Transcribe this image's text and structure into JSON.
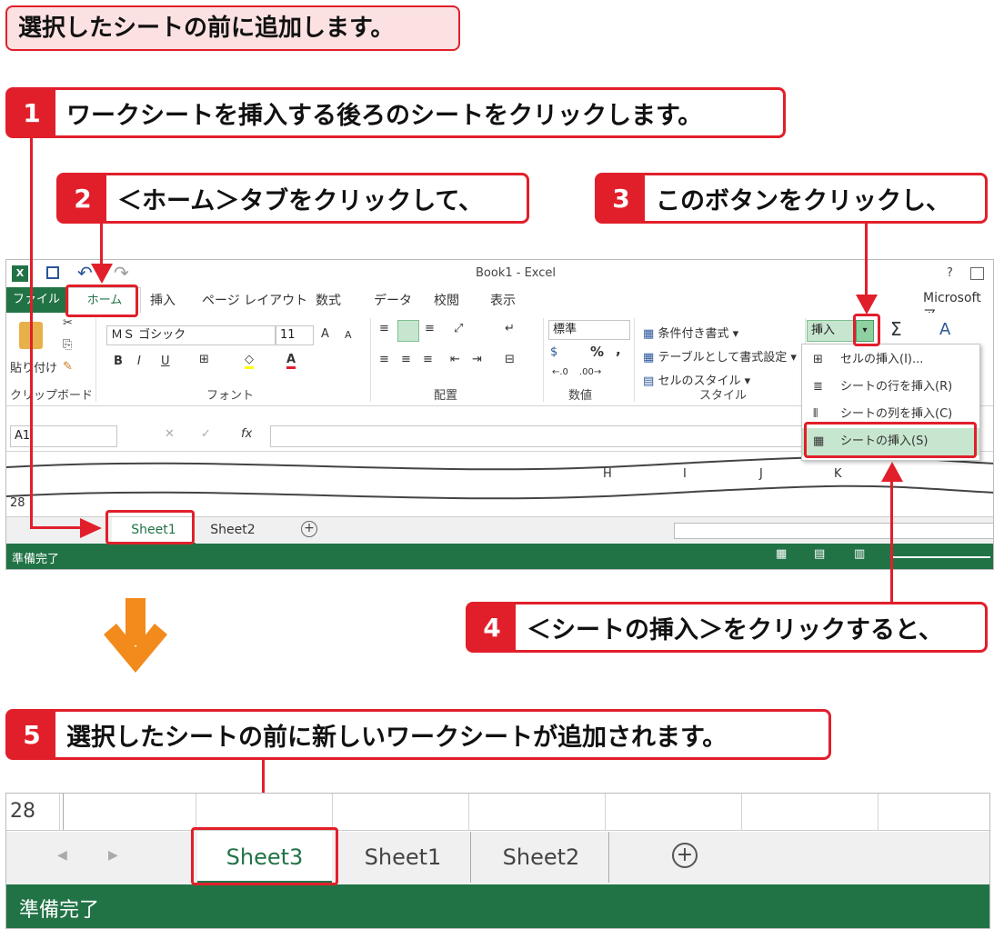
{
  "header_title": "選択したシートの前に追加します。",
  "steps": {
    "s1": {
      "num": "1",
      "text": "ワークシートを挿入する後ろのシートをクリックします。"
    },
    "s2": {
      "num": "2",
      "text": "＜ホーム＞タブをクリックして、"
    },
    "s3": {
      "num": "3",
      "text": "このボタンをクリックし、"
    },
    "s4": {
      "num": "4",
      "text": "＜シートの挿入＞をクリックすると、"
    },
    "s5": {
      "num": "5",
      "text": "選択したシートの前に新しいワークシートが追加されます。"
    }
  },
  "excel": {
    "window_title": "Book1 - Excel",
    "help": "?",
    "account": "Microsoft ア",
    "tabs": {
      "file": "ファイル",
      "home": "ホーム",
      "insert": "挿入",
      "layout": "ページ レイアウト",
      "formula": "数式",
      "data": "データ",
      "review": "校閲",
      "view": "表示"
    },
    "clipboard": {
      "paste": "貼り付け",
      "label": "クリップボード"
    },
    "font": {
      "name": "ＭＳ ゴシック",
      "size": "11",
      "bold": "B",
      "italic": "I",
      "underline": "U",
      "label": "フォント"
    },
    "alignment": {
      "label": "配置"
    },
    "number": {
      "format": "標準",
      "percent": "%",
      "comma": ",",
      "label": "数値"
    },
    "styles": {
      "conditional": "条件付き書式 ▾",
      "table": "テーブルとして書式設定 ▾",
      "cell": "セルのスタイル ▾",
      "label": "スタイル"
    },
    "cells": {
      "insert": "挿入"
    },
    "sum": "Σ",
    "name_box": "A1",
    "fx": "fx",
    "columns": [
      "H",
      "I",
      "J",
      "K"
    ],
    "row_number": "28",
    "dropdown": [
      "セルの挿入(I)...",
      "シートの行を挿入(R)",
      "シートの列を挿入(C)",
      "シートの挿入(S)"
    ],
    "sheets": [
      "Sheet1",
      "Sheet2"
    ],
    "status": "準備完了"
  },
  "result": {
    "row_number": "28",
    "sheets": [
      "Sheet3",
      "Sheet1",
      "Sheet2"
    ],
    "status": "準備完了"
  },
  "colors": {
    "accent_red": "#e11f2b",
    "excel_green": "#217346",
    "arrow_orange": "#f28a1c",
    "title_bg": "#fbe1e2"
  }
}
